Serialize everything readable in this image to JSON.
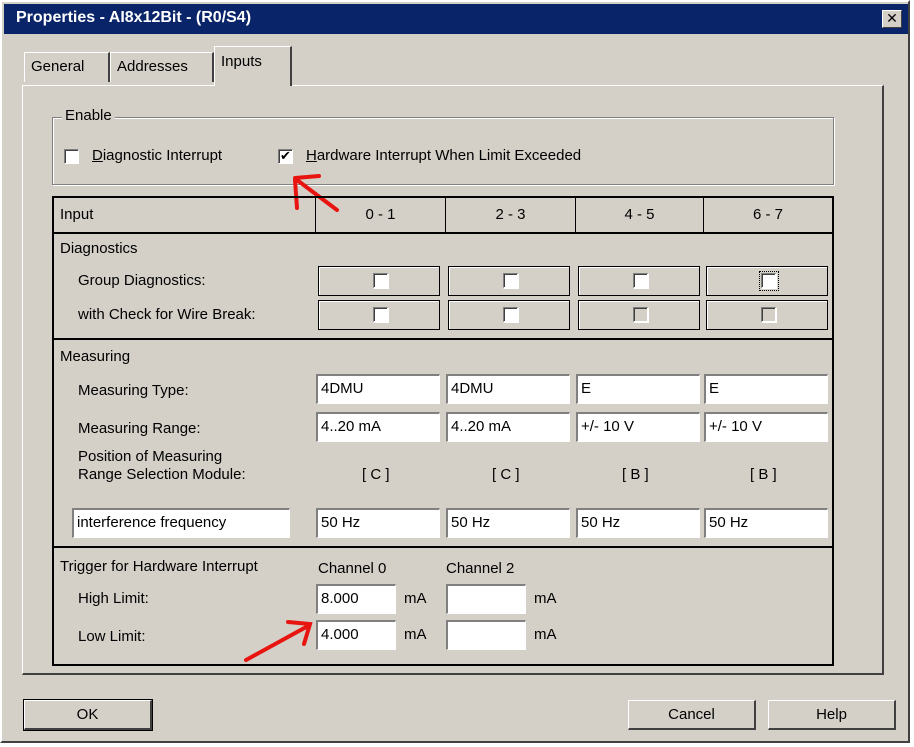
{
  "window": {
    "title": "Properties - AI8x12Bit - (R0/S4)",
    "close_glyph": "✕"
  },
  "tabs": [
    {
      "label": "General"
    },
    {
      "label": "Addresses"
    },
    {
      "label": "Inputs"
    }
  ],
  "active_tab": "Inputs",
  "enable": {
    "group_label": "Enable",
    "diagnostic_interrupt": {
      "label": "Diagnostic Interrupt",
      "checked": false
    },
    "hardware_interrupt": {
      "label": "Hardware Interrupt When Limit Exceeded",
      "checked": true
    }
  },
  "grid": {
    "header": {
      "input": "Input",
      "columns": [
        "0 - 1",
        "2 - 3",
        "4 - 5",
        "6 - 7"
      ]
    },
    "diagnostics": {
      "section": "Diagnostics",
      "group_diagnostics": {
        "label": "Group Diagnostics:",
        "values": [
          false,
          false,
          false,
          false
        ],
        "enabled": [
          true,
          true,
          true,
          true
        ]
      },
      "wire_break": {
        "label": "with Check for Wire Break:",
        "values": [
          false,
          false,
          false,
          false
        ],
        "enabled": [
          true,
          true,
          false,
          false
        ]
      }
    },
    "measuring": {
      "section": "Measuring",
      "type": {
        "label": "Measuring Type:",
        "values": [
          "4DMU",
          "4DMU",
          "E",
          "E"
        ]
      },
      "range": {
        "label": "Measuring Range:",
        "values": [
          "4..20 mA",
          "4..20 mA",
          "+/- 10 V",
          "+/- 10 V"
        ]
      },
      "position": {
        "label_line1": "Position of Measuring",
        "label_line2": "Range Selection Module:",
        "values": [
          "[ C ]",
          "[ C ]",
          "[ B ]",
          "[ B ]"
        ]
      },
      "interference": {
        "label": "interference frequency",
        "values": [
          "50 Hz",
          "50 Hz",
          "50 Hz",
          "50 Hz"
        ]
      }
    },
    "trigger": {
      "section": "Trigger for Hardware Interrupt",
      "channel_headers": [
        "Channel 0",
        "Channel 2"
      ],
      "high": {
        "label": "High Limit:",
        "values": [
          "8.000",
          ""
        ],
        "unit": "mA"
      },
      "low": {
        "label": "Low Limit:",
        "values": [
          "4.000",
          ""
        ],
        "unit": "mA"
      }
    }
  },
  "buttons": {
    "ok": "OK",
    "cancel": "Cancel",
    "help": "Help"
  },
  "colors": {
    "titlebar": "#0a246a",
    "face": "#d4d0c8",
    "annotation": "#e8140f"
  }
}
